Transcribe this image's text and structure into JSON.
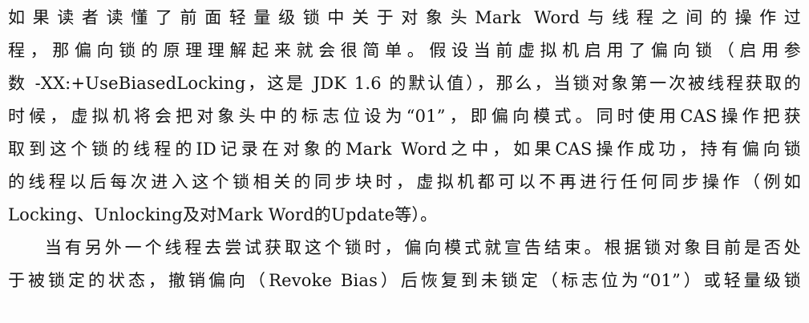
{
  "document": {
    "paragraph1": [
      "如果读者读懂了前面轻量级锁中关于对象头Mark Word与线程之间的操作过",
      "程，那偏向锁的原理理解起来就会很简单。假设当前虚拟机启用了偏向锁（启用参",
      "数 -XX:+UseBiasedLocking，这是 JDK 1.6 的默认值），那么，当锁对象第一次被线程获取的",
      "时候，虚拟机将会把对象头中的标志位设为“01”，即偏向模式。同时使用CAS操作把获",
      "取到这个锁的线程的ID记录在对象的Mark Word之中，如果CAS操作成功，持有偏向锁",
      "的线程以后每次进入这个锁相关的同步块时，虚拟机都可以不再进行任何同步操作（例如",
      "Locking、Unlocking及对Mark Word的Update等）。"
    ],
    "paragraph2": [
      "当有另外一个线程去尝试获取这个锁时，偏向模式就宣告结束。根据锁对象目前是否处",
      "于被锁定的状态，撤销偏向（Revoke Bias）后恢复到未锁定（标志位为“01”）或轻量级锁"
    ]
  }
}
